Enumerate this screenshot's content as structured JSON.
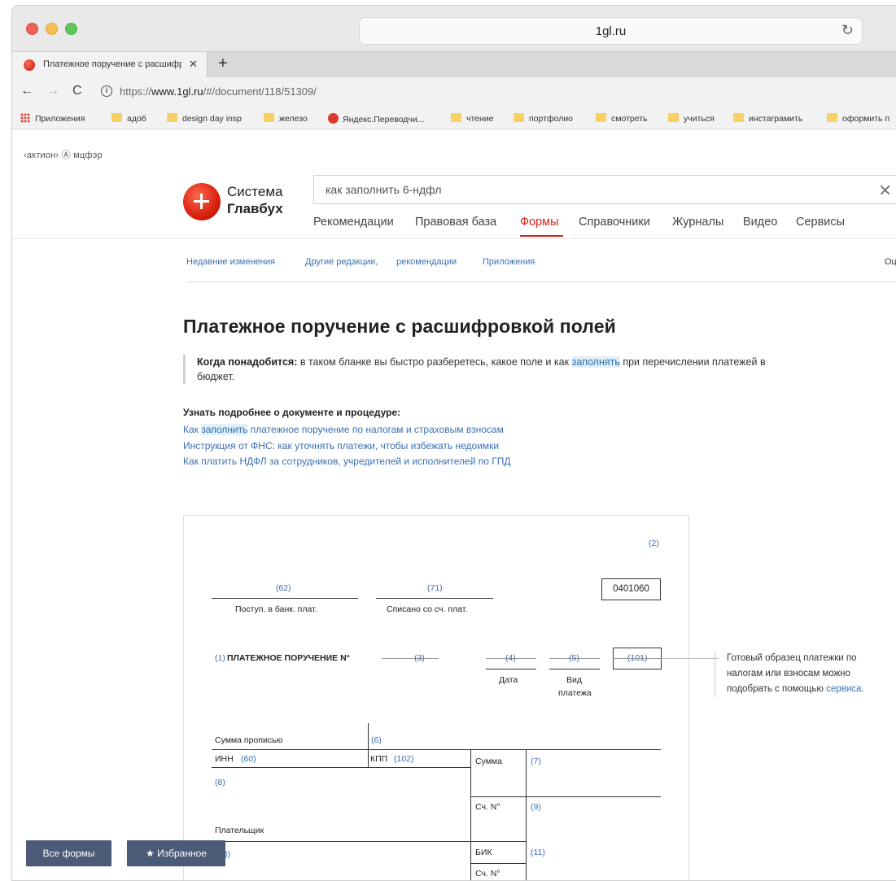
{
  "browser": {
    "host": "1gl.ru",
    "tab_title": "Платежное поручение с расшифр",
    "url_prefix": "https://",
    "url_host": "www.1gl.ru",
    "url_path": "/#/document/118/51309/",
    "bookmarks": [
      {
        "label": "Приложения",
        "icon": "apps-grid-icon"
      },
      {
        "label": "адоб",
        "icon": "folder-icon"
      },
      {
        "label": "design day insp",
        "icon": "folder-icon"
      },
      {
        "label": "железо",
        "icon": "folder-icon"
      },
      {
        "label": "Яндекс.Переводчи...",
        "icon": "yandex-translate-icon"
      },
      {
        "label": "чтение",
        "icon": "folder-icon"
      },
      {
        "label": "портфолио",
        "icon": "folder-icon"
      },
      {
        "label": "смотреть",
        "icon": "folder-icon"
      },
      {
        "label": "учиться",
        "icon": "folder-icon"
      },
      {
        "label": "инстаграмить",
        "icon": "folder-icon"
      },
      {
        "label": "оформить п",
        "icon": "folder-icon"
      }
    ]
  },
  "site": {
    "top_brand": "‹актион› Ⓐ мцфэр",
    "logo_line1": "Система",
    "logo_line2": "Главбух",
    "search_value": "как заполнить 6-ндфл",
    "nav": [
      "Рекомендации",
      "Правовая база",
      "Формы",
      "Справочники",
      "Журналы",
      "Видео",
      "Сервисы"
    ],
    "nav_active": "Формы",
    "subnav": [
      "Недавние изменения",
      "Другие редакции,",
      "рекомендации",
      "Приложения"
    ],
    "subnav_right": "Оц"
  },
  "article": {
    "title": "Платежное поручение с расшифровкой полей",
    "lead_label": "Когда понадобится:",
    "lead_text_1": " в таком бланке вы быстро разберетесь, какое поле и как ",
    "lead_highlight": "заполнять",
    "lead_text_2": " при перечислении платежей в бюджет.",
    "more_title": "Узнать подробнее о документе и процедуре:",
    "link1_pre": "Как ",
    "link1_hl": "заполнить",
    "link1_post": " платежное поручение по налогам и страховым взносам",
    "link2": "Инструкция от ФНС: как уточнять платежи, чтобы избежать недоимки",
    "link3": "Как платить НДФЛ за сотрудников, учредителей и исполнителей по ГПД"
  },
  "form": {
    "f2": "(2)",
    "f62": "(62)",
    "f71": "(71)",
    "code": "0401060",
    "postup": "Поступ. в банк. плат.",
    "spisano": "Списано со сч. плат.",
    "f1": "(1)",
    "pp_title": "ПЛАТЕЖНОЕ ПОРУЧЕНИЕ N°",
    "f3": "(3)",
    "f4": "(4)",
    "f5": "(5)",
    "f101": "(101)",
    "date": "Дата",
    "vid1": "Вид",
    "vid2": "платежа",
    "summa_propisyu": "Сумма прописью",
    "f6": "(6)",
    "inn": "ИНН",
    "f60": "(60)",
    "kpp": "КПП",
    "f102": "(102)",
    "summa": "Сумма",
    "f7": "(7)",
    "f8": "(8)",
    "sch": "Сч. N°",
    "f9": "(9)",
    "platelshik": "Плательщик",
    "bik": "БИК",
    "f11": "(11)",
    "sch2": "Сч. N°",
    "f10_partial": "))"
  },
  "tip": {
    "text": "Готовый образец платежки по налогам или взносам можно подобрать с помощью ",
    "link": "сервиса",
    "tail": "."
  },
  "buttons": {
    "all_forms": "Все формы",
    "favorites": "Избранное",
    "star": "★"
  }
}
